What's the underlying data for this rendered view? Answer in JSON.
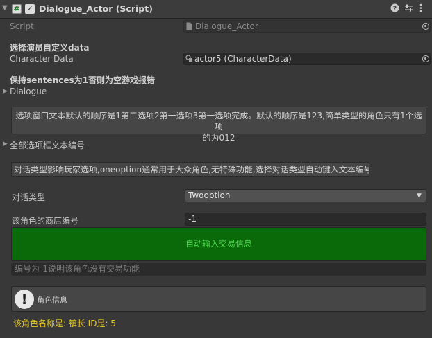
{
  "header": {
    "title": "Dialogue_Actor (Script)",
    "enabled": true
  },
  "script_field": {
    "label": "Script",
    "value": "Dialogue_Actor"
  },
  "section_actor": {
    "heading": "选择演员自定义data",
    "character_label": "Character Data",
    "character_value": "actor5 (CharacterData)"
  },
  "section_sentences": {
    "heading": "保持sentences为1否则为空游戏报错",
    "dialogue_label": "Dialogue"
  },
  "help1": {
    "line1": "选项窗口文本默认的顺序是1第二选项2第一选项3第一选项完成。默认的顺序是123,简单类型的角色只有1个选项",
    "line2": "的为012"
  },
  "all_options_label": "全部选项框文本编号",
  "help2": {
    "text": "对话类型影响玩家选项,oneoption通常用于大众角色,无特殊功能,选择对话类型自动键入文本编号"
  },
  "dialogue_type": {
    "label": "对话类型",
    "value": "Twooption"
  },
  "shop": {
    "label": "该角色的商店编号",
    "value": "-1"
  },
  "trade_button": {
    "label": "自动输入交易信息"
  },
  "shop_hint": {
    "placeholder": "编号为-1说明该角色没有交易功能"
  },
  "info_box": {
    "label": "角色信息"
  },
  "role_summary": {
    "text": "该角色名称是: 镇长  ID是: 5"
  },
  "colors": {
    "background": "#383838",
    "green_button": "#0a6a0a",
    "green_text": "#4fd64f",
    "yellow_text": "#e6c722"
  },
  "icons": {
    "fold": "triangle-down-icon",
    "script": "script-hash-icon",
    "help": "help-icon",
    "presets": "presets-icon",
    "menu": "kebab-menu-icon",
    "info": "exclamation-info-icon"
  }
}
